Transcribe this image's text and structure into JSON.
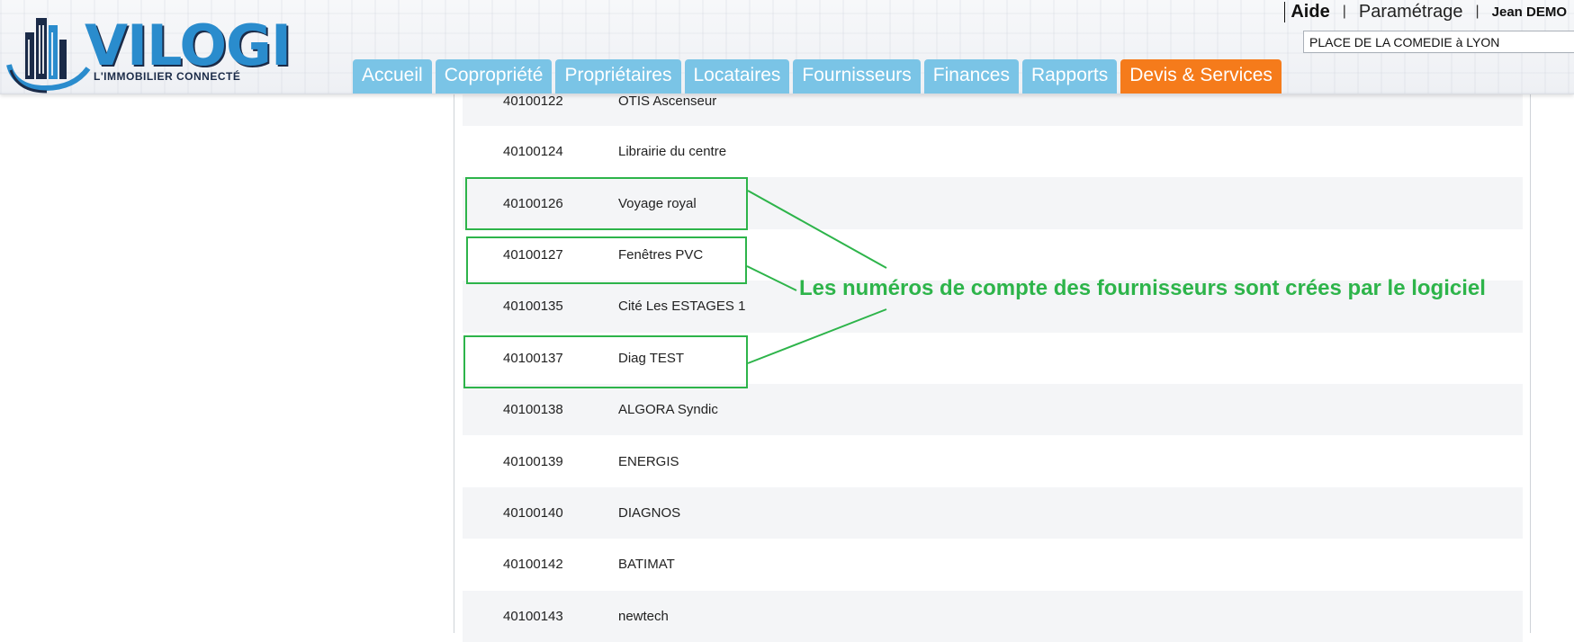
{
  "header": {
    "logo_text": "VILOGI",
    "logo_tagline": "L'IMMOBILIER CONNECTÉ",
    "links": {
      "aide": "Aide",
      "parametrage": "Paramétrage",
      "separator": "|",
      "user": "Jean DEMO"
    },
    "site_selector": {
      "value": "PLACE DE LA COMEDIE à LYON"
    },
    "nav_tabs": [
      {
        "label": "Accueil",
        "active": false
      },
      {
        "label": "Copropriété",
        "active": false
      },
      {
        "label": "Propriétaires",
        "active": false
      },
      {
        "label": "Locataires",
        "active": false
      },
      {
        "label": "Fournisseurs",
        "active": false
      },
      {
        "label": "Finances",
        "active": false
      },
      {
        "label": "Rapports",
        "active": false
      },
      {
        "label": "Devis & Services",
        "active": true
      }
    ]
  },
  "suppliers": {
    "rows": [
      {
        "account": "40100122",
        "name": "OTIS Ascenseur"
      },
      {
        "account": "40100124",
        "name": "Librairie du centre"
      },
      {
        "account": "40100126",
        "name": "Voyage royal"
      },
      {
        "account": "40100127",
        "name": "Fenêtres PVC"
      },
      {
        "account": "40100135",
        "name": "Cité Les ESTAGES 1"
      },
      {
        "account": "40100137",
        "name": "Diag TEST"
      },
      {
        "account": "40100138",
        "name": "ALGORA Syndic"
      },
      {
        "account": "40100139",
        "name": "ENERGIS"
      },
      {
        "account": "40100140",
        "name": "DIAGNOS"
      },
      {
        "account": "40100142",
        "name": "BATIMAT"
      },
      {
        "account": "40100143",
        "name": "newtech"
      }
    ]
  },
  "annotation": {
    "text": "Les numéros de compte des fournisseurs sont crées par le logiciel",
    "color": "#2db44a"
  },
  "colors": {
    "tab": "#7ac4e6",
    "tab_active": "#f57b1b",
    "row_alt": "#f4f5f7",
    "logo_blue": "#2a8ccd",
    "logo_dark": "#1b2b48"
  }
}
